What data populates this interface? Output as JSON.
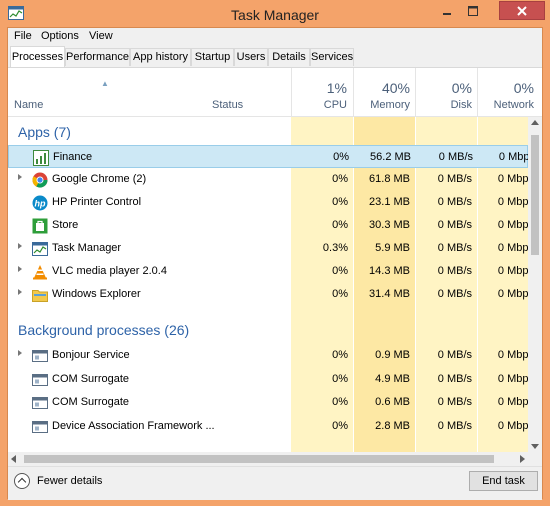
{
  "window": {
    "title": "Task Manager"
  },
  "colors": {
    "titlebar": "#f4a36a",
    "group_heading": "#2e63a8",
    "heat_light": "#fff4c4",
    "heat_medium": "#fde8a4",
    "close_button": "#c75050",
    "selection": "#cde8f5"
  },
  "menu": {
    "items": [
      "File",
      "Options",
      "View"
    ]
  },
  "tabs": [
    "Processes",
    "Performance",
    "App history",
    "Startup",
    "Users",
    "Details",
    "Services"
  ],
  "active_tab": "Processes",
  "columns": {
    "name": "Name",
    "status": "Status",
    "cpu": {
      "pct": "1%",
      "label": "CPU"
    },
    "memory": {
      "pct": "40%",
      "label": "Memory"
    },
    "disk": {
      "pct": "0%",
      "label": "Disk"
    },
    "network": {
      "pct": "0%",
      "label": "Network"
    }
  },
  "groups": {
    "apps": {
      "title": "Apps (7)",
      "rows": [
        {
          "name": "Finance",
          "icon": "finance-icon",
          "expandable": false,
          "cpu": "0%",
          "memory": "56.2 MB",
          "disk": "0 MB/s",
          "network": "0 Mbps"
        },
        {
          "name": "Google Chrome (2)",
          "icon": "chrome-icon",
          "expandable": true,
          "cpu": "0%",
          "memory": "61.8 MB",
          "disk": "0 MB/s",
          "network": "0 Mbps"
        },
        {
          "name": "HP Printer Control",
          "icon": "hp-icon",
          "expandable": false,
          "cpu": "0%",
          "memory": "23.1 MB",
          "disk": "0 MB/s",
          "network": "0 Mbps"
        },
        {
          "name": "Store",
          "icon": "store-icon",
          "expandable": false,
          "cpu": "0%",
          "memory": "30.3 MB",
          "disk": "0 MB/s",
          "network": "0 Mbps"
        },
        {
          "name": "Task Manager",
          "icon": "task-manager-icon",
          "expandable": true,
          "cpu": "0.3%",
          "memory": "5.9 MB",
          "disk": "0 MB/s",
          "network": "0 Mbps"
        },
        {
          "name": "VLC media player 2.0.4",
          "icon": "vlc-icon",
          "expandable": true,
          "cpu": "0%",
          "memory": "14.3 MB",
          "disk": "0 MB/s",
          "network": "0 Mbps"
        },
        {
          "name": "Windows Explorer",
          "icon": "explorer-folder-icon",
          "expandable": true,
          "cpu": "0%",
          "memory": "31.4 MB",
          "disk": "0 MB/s",
          "network": "0 Mbps"
        }
      ]
    },
    "background": {
      "title": "Background processes (26)",
      "rows": [
        {
          "name": "Bonjour Service",
          "icon": "service-window-icon",
          "expandable": true,
          "cpu": "0%",
          "memory": "0.9 MB",
          "disk": "0 MB/s",
          "network": "0 Mbps"
        },
        {
          "name": "COM Surrogate",
          "icon": "service-window-icon",
          "expandable": false,
          "cpu": "0%",
          "memory": "4.9 MB",
          "disk": "0 MB/s",
          "network": "0 Mbps"
        },
        {
          "name": "COM Surrogate",
          "icon": "service-window-icon",
          "expandable": false,
          "cpu": "0%",
          "memory": "0.6 MB",
          "disk": "0 MB/s",
          "network": "0 Mbps"
        },
        {
          "name": "Device Association Framework ...",
          "icon": "service-window-icon",
          "expandable": false,
          "cpu": "0%",
          "memory": "2.8 MB",
          "disk": "0 MB/s",
          "network": "0 Mbps"
        }
      ]
    }
  },
  "footer": {
    "fewer_details": "Fewer details",
    "end_task": "End task"
  }
}
